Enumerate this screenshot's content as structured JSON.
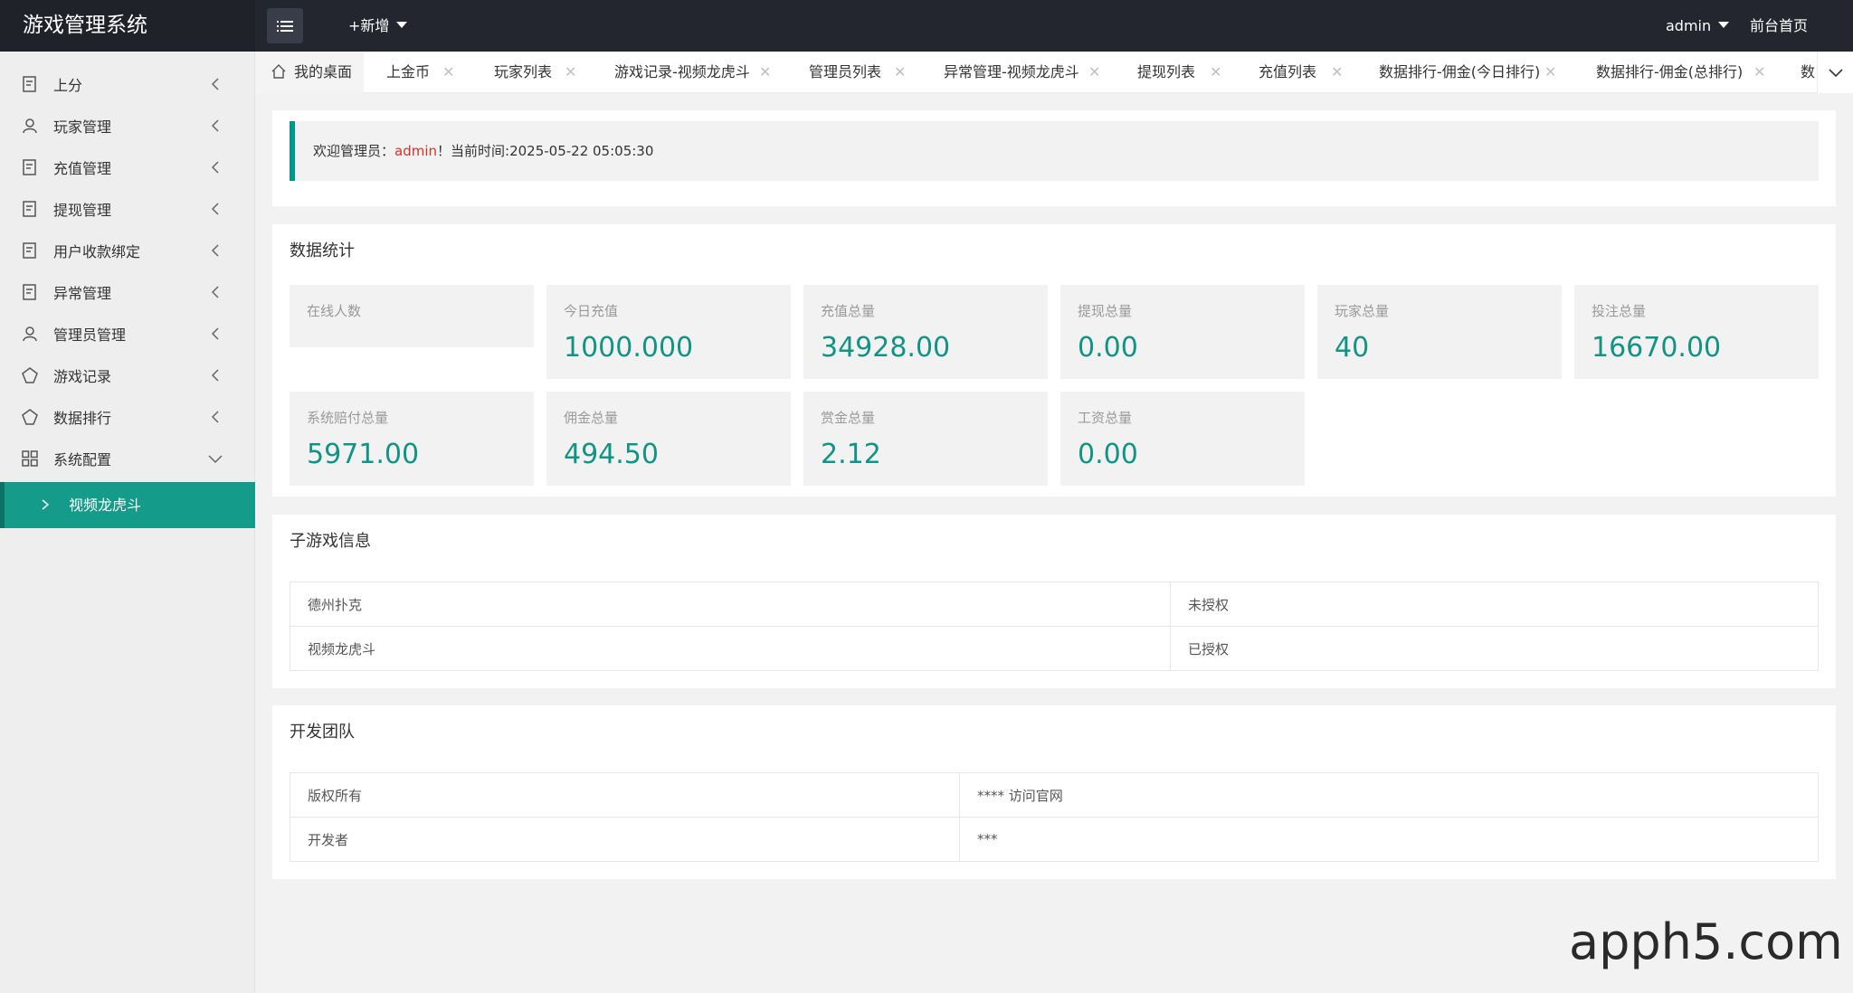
{
  "header": {
    "logo": "游戏管理系统",
    "add_new": "+新增",
    "admin": "admin",
    "front_home": "前台首页"
  },
  "sidebar": {
    "items": [
      {
        "label": "上分",
        "icon": "receipt-icon"
      },
      {
        "label": "玩家管理",
        "icon": "user-icon"
      },
      {
        "label": "充值管理",
        "icon": "receipt-icon"
      },
      {
        "label": "提现管理",
        "icon": "receipt-icon"
      },
      {
        "label": "用户收款绑定",
        "icon": "receipt-icon"
      },
      {
        "label": "异常管理",
        "icon": "receipt-icon"
      },
      {
        "label": "管理员管理",
        "icon": "user-icon"
      },
      {
        "label": "游戏记录",
        "icon": "diamond-icon"
      },
      {
        "label": "数据排行",
        "icon": "diamond-icon"
      },
      {
        "label": "系统配置",
        "icon": "grid-icon"
      }
    ],
    "sub_item": "视频龙虎斗"
  },
  "tabs": [
    {
      "label": "我的桌面"
    },
    {
      "label": "上金币"
    },
    {
      "label": "玩家列表"
    },
    {
      "label": "游戏记录-视频龙虎斗"
    },
    {
      "label": "管理员列表"
    },
    {
      "label": "异常管理-视频龙虎斗"
    },
    {
      "label": "提现列表"
    },
    {
      "label": "充值列表"
    },
    {
      "label": "数据排行-佣金(今日排行)"
    },
    {
      "label": "数据排行-佣金(总排行)"
    },
    {
      "label": "数"
    }
  ],
  "welcome": {
    "prefix": "欢迎管理员：",
    "user": "admin",
    "suffix": "！当前时间:2025-05-22 05:05:30"
  },
  "stats": {
    "title": "数据统计",
    "items": [
      {
        "label": "在线人数",
        "value": ""
      },
      {
        "label": "今日充值",
        "value": "1000.000"
      },
      {
        "label": "充值总量",
        "value": "34928.00"
      },
      {
        "label": "提现总量",
        "value": "0.00"
      },
      {
        "label": "玩家总量",
        "value": "40"
      },
      {
        "label": "投注总量",
        "value": "16670.00"
      },
      {
        "label": "系统赔付总量",
        "value": "5971.00"
      },
      {
        "label": "佣金总量",
        "value": "494.50"
      },
      {
        "label": "赏金总量",
        "value": "2.12"
      },
      {
        "label": "工资总量",
        "value": "0.00"
      }
    ]
  },
  "subgames": {
    "title": "子游戏信息",
    "rows": [
      {
        "name": "德州扑克",
        "status": "未授权"
      },
      {
        "name": "视频龙虎斗",
        "status": "已授权"
      }
    ]
  },
  "devteam": {
    "title": "开发团队",
    "rows": [
      {
        "key": "版权所有",
        "value": "**** 访问官网"
      },
      {
        "key": "开发者",
        "value": "***"
      }
    ]
  },
  "watermark": "apph5.com"
}
